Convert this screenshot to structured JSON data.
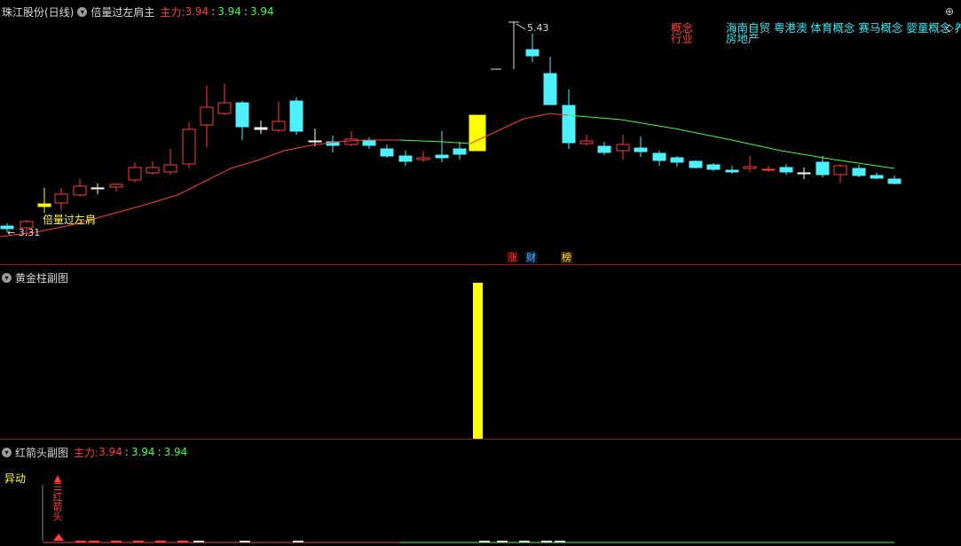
{
  "main": {
    "stock_name": "珠江股份(日线)",
    "indicator_name": "倍量过左肩主",
    "mainforce_label": "主力:",
    "v1": "3.94",
    "sep1": ":",
    "v2": "3.94",
    "sep2": ":",
    "v3": "3.94",
    "high_marker": "5.43",
    "low_marker": "3.31",
    "signal_text": "倍量过左肩",
    "concept_label": "概念",
    "industry_label": "行业",
    "concepts": "海南自贸 粤港澳 体育概念 赛马概念 婴童概念 养老概",
    "industry": "房地产",
    "tag_zhang": "涨",
    "tag_cai": "财",
    "tag_bang": "榜",
    "colors": {
      "up": "#ff3b3b",
      "down": "#4df0ff",
      "ma_up": "#ff3b3b",
      "ma_down": "#3cff3c",
      "signal": "#ffff00"
    }
  },
  "volume_pane": {
    "title": "黄金柱副图"
  },
  "arrow_pane": {
    "title": "红箭头副图",
    "mainforce_label": "主力:",
    "v1": "3.94",
    "sep1": ":",
    "v2": "3.94",
    "sep2": ":",
    "v3": "3.94",
    "signal_label": "异动",
    "arrow_text": "红箭头"
  },
  "icons": [
    "zoom-icon",
    "diamond-icon",
    "chevron-down-icon"
  ]
}
